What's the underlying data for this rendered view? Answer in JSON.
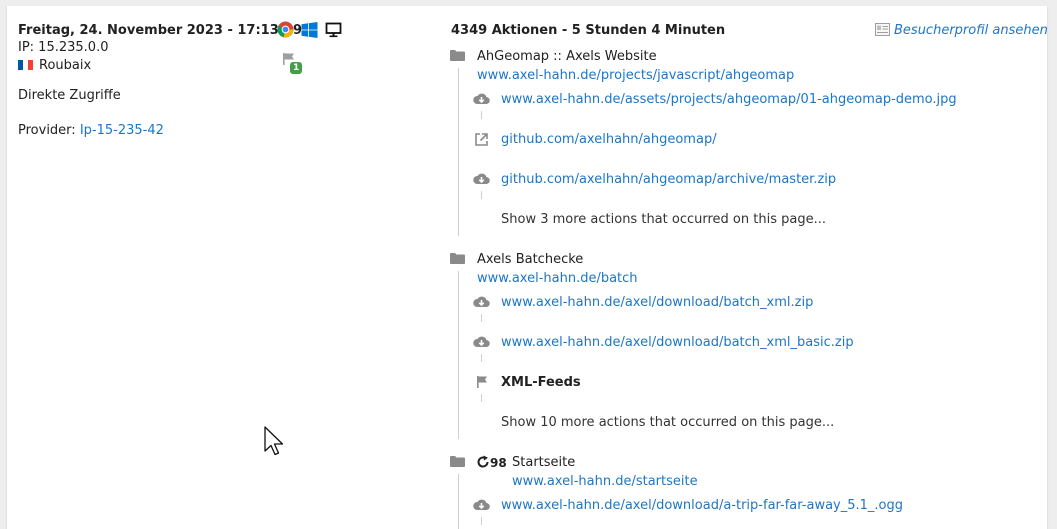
{
  "visit": {
    "datetime": "Freitag, 24. November 2023 - 17:13:19",
    "ip": "IP: 15.235.0.0",
    "city": "Roubaix",
    "referrer": "Direkte Zugriffe",
    "provider_label": "Provider:",
    "provider_value": "Ip-15-235-42",
    "goal_badge": "1"
  },
  "summary": "4349 Aktionen - 5 Stunden 4 Minuten",
  "profile_link": "Besucherprofil ansehen",
  "pages": [
    {
      "title": "AhGeomap :: Axels Website",
      "url": "www.axel-hahn.de/projects/javascript/ahgeomap",
      "actions": [
        {
          "type": "download",
          "text": "www.axel-hahn.de/assets/projects/ahgeomap/01-ahgeomap-demo.jpg"
        },
        {
          "type": "outlink",
          "text": "github.com/axelhahn/ahgeomap/"
        },
        {
          "type": "download",
          "text": "github.com/axelhahn/ahgeomap/archive/master.zip"
        }
      ],
      "more": "Show 3 more actions that occurred on this page..."
    },
    {
      "title": "Axels Batchecke",
      "url": "www.axel-hahn.de/batch",
      "actions": [
        {
          "type": "download",
          "text": "www.axel-hahn.de/axel/download/batch_xml.zip"
        },
        {
          "type": "download",
          "text": "www.axel-hahn.de/axel/download/batch_xml_basic.zip"
        },
        {
          "type": "event",
          "text": "XML-Feeds"
        }
      ],
      "more": "Show 10 more actions that occurred on this page..."
    },
    {
      "title": "Startseite",
      "refresh_count": "98",
      "url": "www.axel-hahn.de/startseite",
      "actions": [
        {
          "type": "download",
          "text": "www.axel-hahn.de/axel/download/a-trip-far-far-away_5.1_.ogg"
        }
      ]
    }
  ],
  "icons": {
    "browser": "chrome-icon",
    "os": "windows-icon",
    "device": "desktop-icon",
    "goal": "flag-icon",
    "profile": "visitor-profile-icon",
    "folder": "folder-icon",
    "download": "download-icon",
    "outlink": "external-link-icon",
    "event": "event-flag-icon",
    "reload": "reload-icon"
  },
  "colors": {
    "link": "#1e76c5",
    "badge": "#43a047",
    "icon_gray": "#8a8a8a"
  }
}
